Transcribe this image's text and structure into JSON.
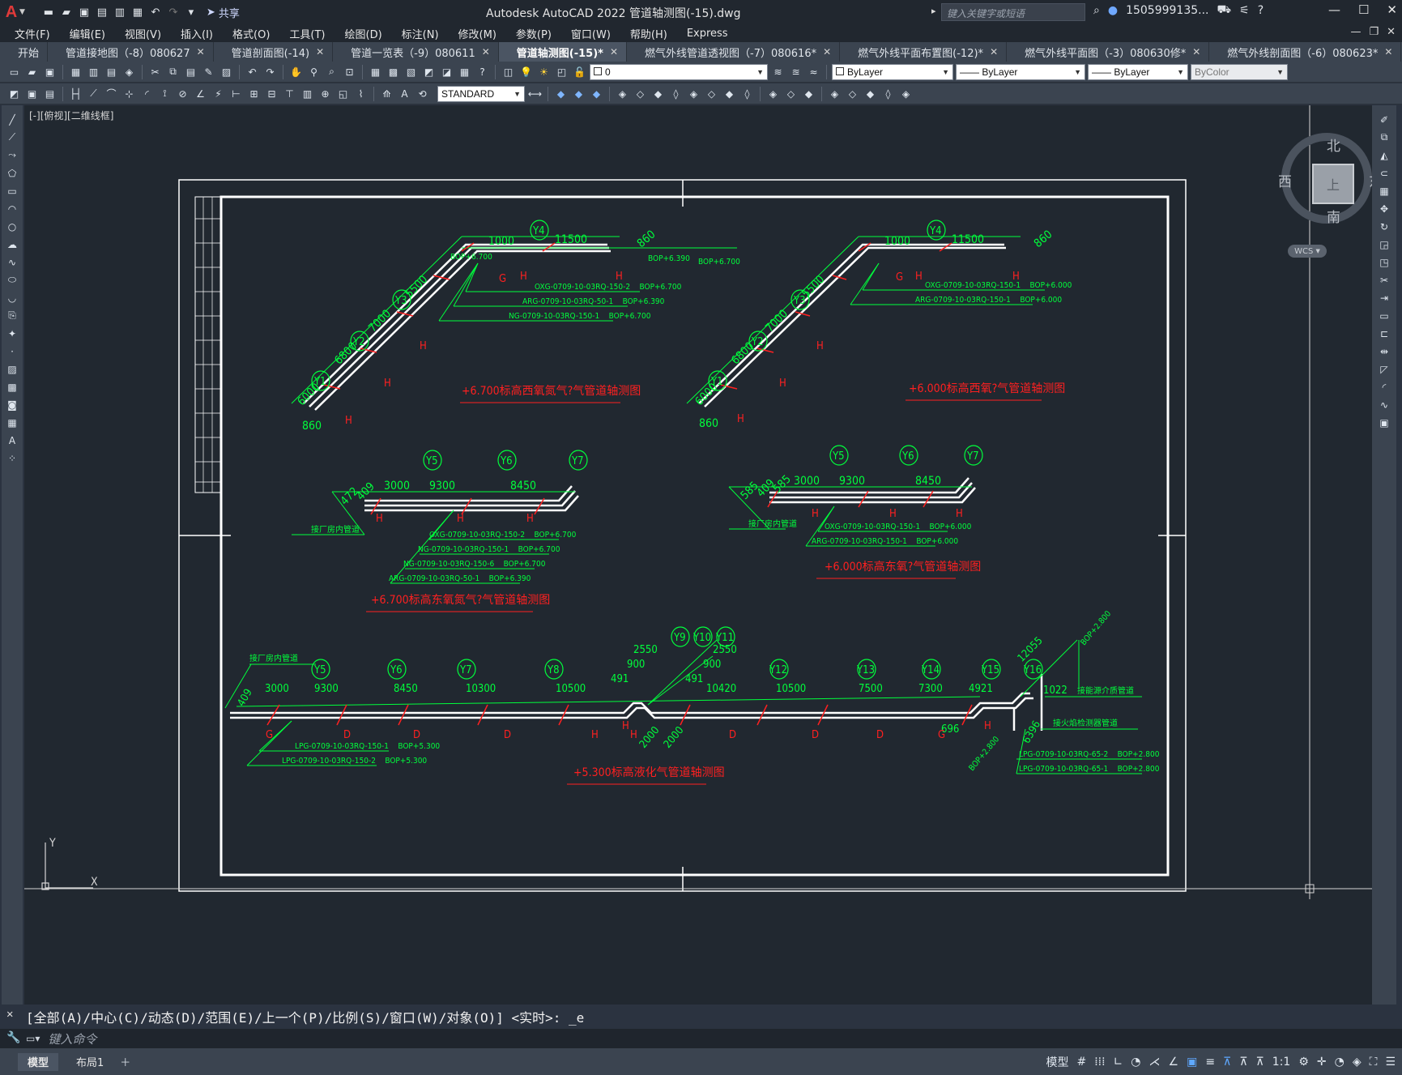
{
  "app": {
    "logo": "A",
    "title": "Autodesk AutoCAD 2022    管道轴测图(-15).dwg",
    "share_label": "共享",
    "search_placeholder": "键入关键字或短语",
    "user": "1505999135...",
    "accent": "#e03a3a"
  },
  "menu": [
    "文件(F)",
    "编辑(E)",
    "视图(V)",
    "插入(I)",
    "格式(O)",
    "工具(T)",
    "绘图(D)",
    "标注(N)",
    "修改(M)",
    "参数(P)",
    "窗口(W)",
    "帮助(H)",
    "Express"
  ],
  "tabs": [
    {
      "label": "开始",
      "closable": false
    },
    {
      "label": "管道接地图（-8）080627",
      "closable": true
    },
    {
      "label": "管道剖面图(-14)",
      "closable": true
    },
    {
      "label": "管道一览表（-9）080611",
      "closable": true
    },
    {
      "label": "管道轴测图(-15)*",
      "closable": true,
      "active": true
    },
    {
      "label": "燃气外线管道透视图（-7）080616*",
      "closable": true
    },
    {
      "label": "燃气外线平面布置图(-12)*",
      "closable": true
    },
    {
      "label": "燃气外线平面图（-3）080630修*",
      "closable": true
    },
    {
      "label": "燃气外线剖面图（-6）080623*",
      "closable": true
    }
  ],
  "properties": {
    "layer": "0",
    "color": "ByLayer",
    "linetype": "ByLayer",
    "lineweight": "ByLayer",
    "plotstyle": "ByColor",
    "textstyle": "STANDARD"
  },
  "viewport_label": "[-][俯视][二维线框]",
  "viewcube": {
    "north": "北",
    "south": "南",
    "east": "东",
    "west": "西",
    "face": "上",
    "wcs": "WCS"
  },
  "ucs": {
    "x": "X",
    "y": "Y"
  },
  "drawing": {
    "lines": {
      "a": {
        "bop1": "BOP+6.700",
        "bop2": "BOP+6.390",
        "bop3": "BOP+6.700",
        "dim_top1": "1000",
        "dim_top2": "11500",
        "dim_top3": "860",
        "dims": [
          "6000",
          "6800",
          "7000",
          "5500",
          "860"
        ],
        "axes": [
          "Y1",
          "Y2",
          "Y3",
          "Y4"
        ],
        "tags": [
          "OXG-0709-10-03RQ-150-2    BOP+6.700",
          "ARG-0709-10-03RQ-50-1    BOP+6.390",
          "NG-0709-10-03RQ-150-1    BOP+6.700"
        ],
        "caption": "+6.700标高西氧氮气?气管道轴测图"
      },
      "b": {
        "dim_top1": "1000",
        "dim_top2": "11500",
        "dim_top3": "860",
        "dims": [
          "6000",
          "6800",
          "7000",
          "5500",
          "860"
        ],
        "axes": [
          "Y1",
          "Y2",
          "Y3",
          "Y4"
        ],
        "tags": [
          "OXG-0709-10-03RQ-150-1    BOP+6.000",
          "ARG-0709-10-03RQ-150-1    BOP+6.000"
        ],
        "caption": "+6.000标高西氧?气管道轴测图"
      },
      "c": {
        "dims": [
          "472",
          "409",
          "3000",
          "9300",
          "8450"
        ],
        "axes": [
          "Y5",
          "Y6",
          "Y7"
        ],
        "label": "接厂房内管道",
        "tags": [
          "OXG-0709-10-03RQ-150-2    BOP+6.700",
          "NG-0709-10-03RQ-150-1    BOP+6.700",
          "NG-0709-10-03RQ-150-6    BOP+6.700",
          "ARG-0709-10-03RQ-50-1    BOP+6.390"
        ],
        "caption": "+6.700标高东氧氮气?气管道轴测图"
      },
      "d": {
        "dims": [
          "585",
          "409",
          "585",
          "3000",
          "9300",
          "8450"
        ],
        "axes": [
          "Y5",
          "Y6",
          "Y7"
        ],
        "label": "接厂房内管道",
        "tags": [
          "OXG-0709-10-03RQ-150-1    BOP+6.000",
          "ARG-0709-10-03RQ-150-1    BOP+6.000"
        ],
        "caption": "+6.000标高东氧?气管道轴测图"
      },
      "e": {
        "dims": [
          "409",
          "3000",
          "9300",
          "8450",
          "10300",
          "10500",
          "491",
          "900",
          "2550",
          "2550",
          "900",
          "491",
          "10420",
          "10500",
          "7500",
          "7300",
          "4921",
          "1022",
          "12055",
          "696",
          "6396",
          "2000",
          "2000"
        ],
        "axes": [
          "Y5",
          "Y6",
          "Y7",
          "Y8",
          "Y9",
          "Y10",
          "Y11",
          "Y12",
          "Y13",
          "Y14",
          "Y15",
          "Y16"
        ],
        "label_left": "接厂房内管道",
        "label_r1": "接能源介质管道",
        "label_r2": "接火焰检测器管道",
        "bop_r": "BOP+2.800",
        "bop_l": "BOP+2.800",
        "tags": [
          "LPG-0709-10-03RQ-150-1    BOP+5.300",
          "LPG-0709-10-03RQ-150-2    BOP+5.300"
        ],
        "tags_r": [
          "LPG-0709-10-03RQ-65-2    BOP+2.800",
          "LPG-0709-10-03RQ-65-1    BOP+2.800"
        ],
        "caption": "+5.300标高液化气管道轴测图"
      }
    },
    "colors": {
      "pipe": "#ffffff",
      "dim": "#00ff3c",
      "mark": "#ff2020",
      "frame": "#ffffff"
    }
  },
  "command": {
    "history": "[全部(A)/中心(C)/动态(D)/范围(E)/上一个(P)/比例(S)/窗口(W)/对象(O)] <实时>: _e",
    "placeholder": "键入命令"
  },
  "layout_tabs": [
    "模型",
    "布局1"
  ],
  "status": {
    "scale": "1:1"
  }
}
